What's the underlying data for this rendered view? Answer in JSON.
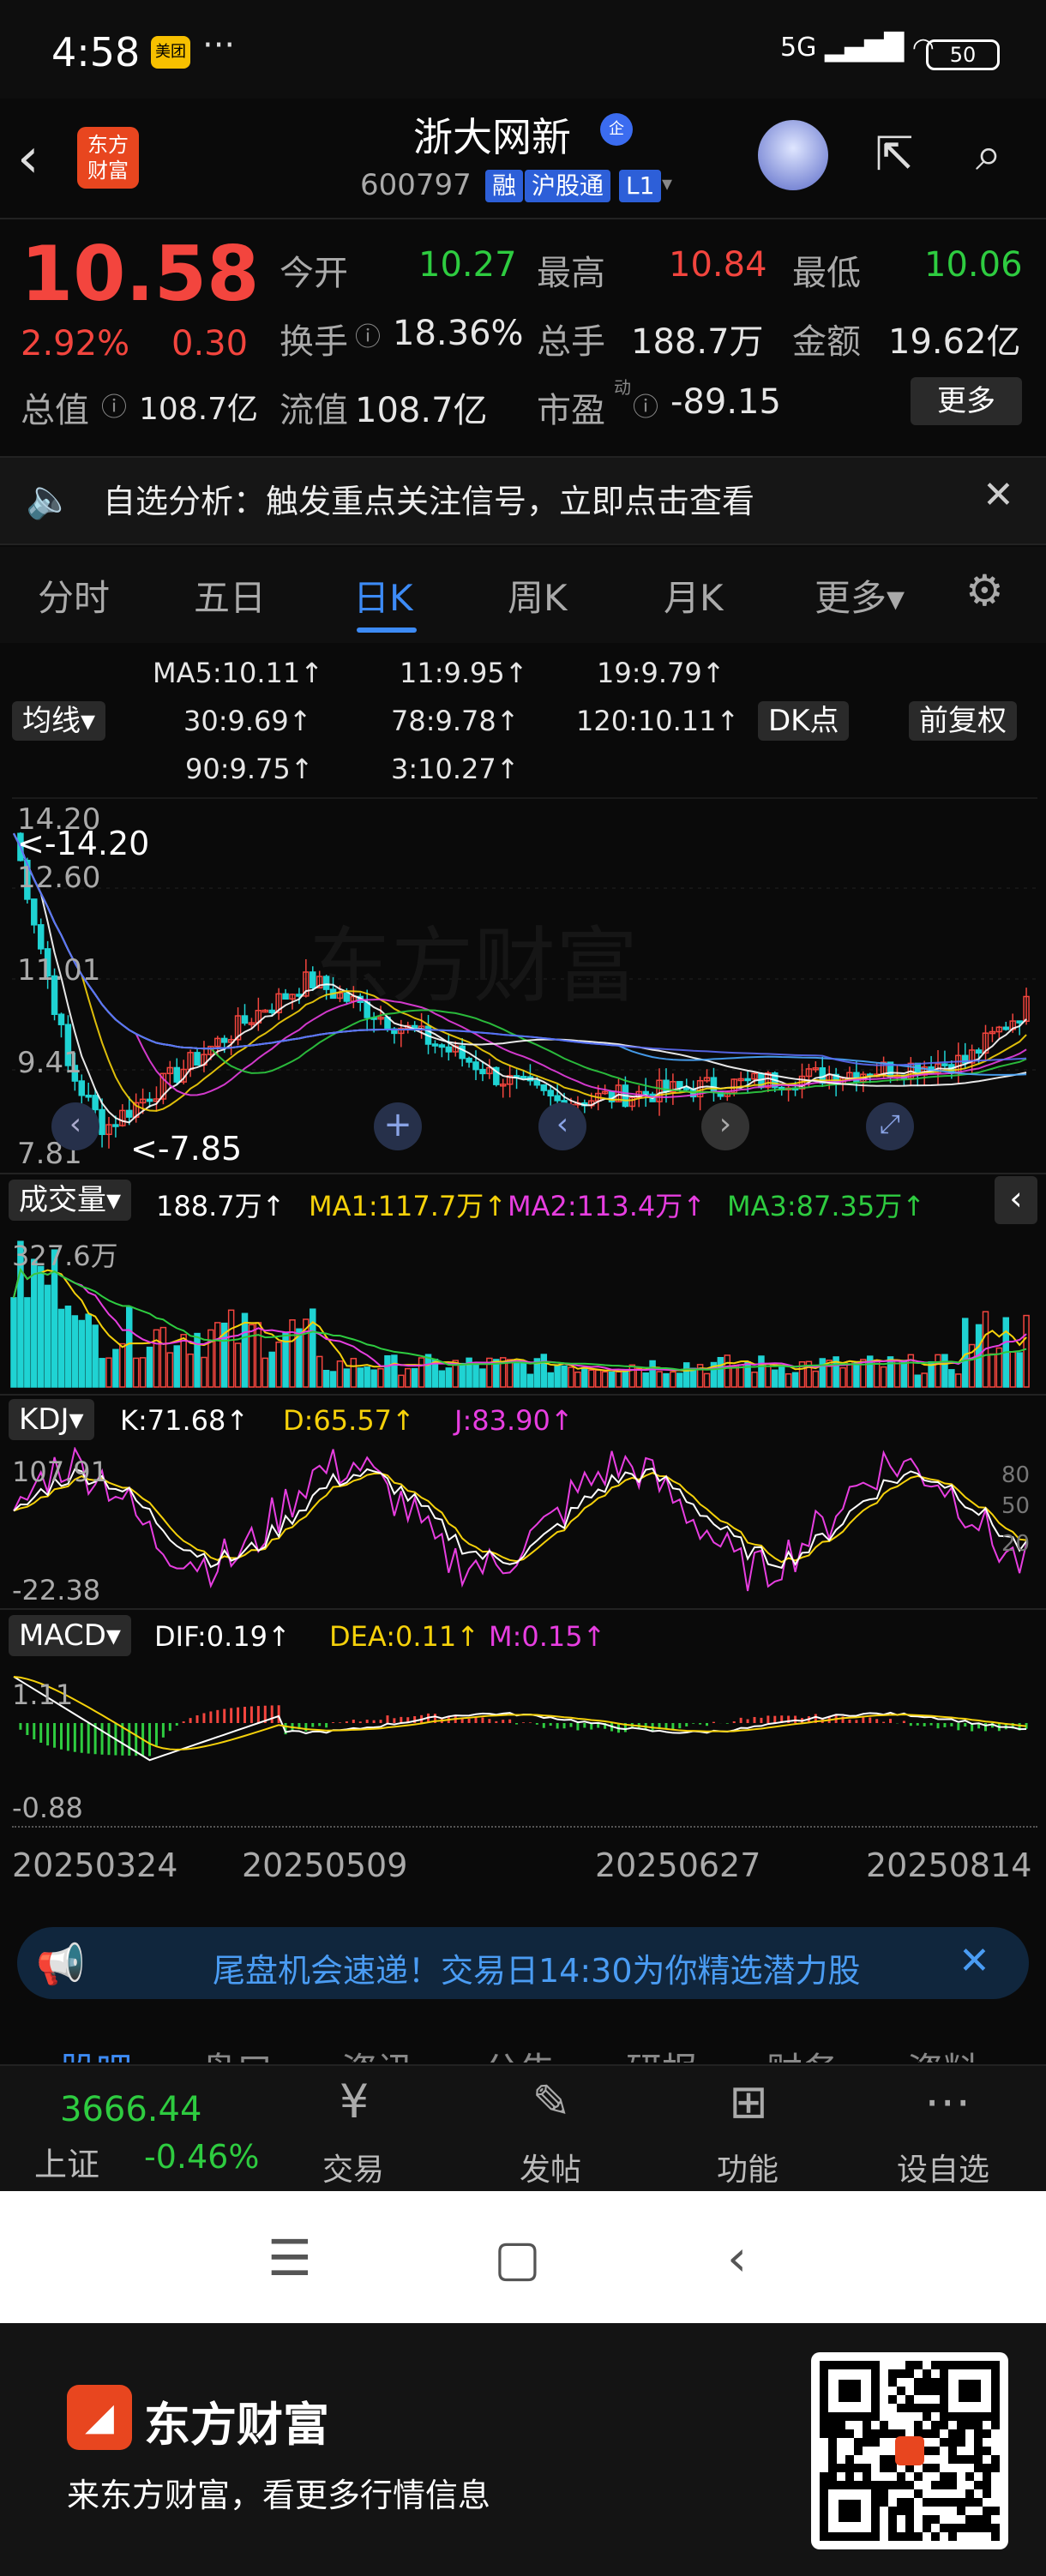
{
  "status_bar": {
    "time": "4:58",
    "app_badge": "美团",
    "dots": "···",
    "signal": "5G",
    "battery": "50"
  },
  "header": {
    "logo_text": "东方\n财富",
    "stock_name": "浙大网新",
    "name_badge": "企",
    "stock_code": "600797",
    "tags": [
      "融",
      "沪股通",
      "L1"
    ]
  },
  "quote": {
    "price": "10.58",
    "pct_change": "2.92%",
    "change": "0.30",
    "open_label": "今开",
    "open": "10.27",
    "high_label": "最高",
    "high": "10.84",
    "low_label": "最低",
    "low": "10.06",
    "turnover_label": "换手",
    "turnover": "18.36%",
    "volume_label": "总手",
    "volume": "188.7万",
    "amount_label": "金额",
    "amount": "19.62亿",
    "mktcap_label": "总值",
    "mktcap": "108.7亿",
    "float_label": "流值",
    "float_cap": "108.7亿",
    "pe_label": "市盈",
    "pe_sup": "动",
    "pe": "-89.15",
    "more_label": "更多",
    "colors": {
      "up": "#f3453e",
      "down": "#2ecc40"
    }
  },
  "notice": {
    "text": "自选分析：触发重点关注信号，立即点击查看"
  },
  "tabs": [
    "分时",
    "五日",
    "日K",
    "周K",
    "月K",
    "更多▾"
  ],
  "active_tab": "日K",
  "ma_legend": {
    "ma_selector": "均线▾",
    "dk_label": "DK点",
    "adjust_label": "前复权",
    "items": [
      {
        "label": "MA5:10.11↑",
        "color": "#ffffff"
      },
      {
        "label": "11:9.95↑",
        "color": "#f5d10a"
      },
      {
        "label": "19:9.79↑",
        "color": "#e73ee0"
      },
      {
        "label": "30:9.69↑",
        "color": "#2ecc40"
      },
      {
        "label": "78:9.78↑",
        "color": "#ffffff"
      },
      {
        "label": "120:10.11↑",
        "color": "#5b6cf5"
      },
      {
        "label": "90:9.75↑",
        "color": "#4aa8ff"
      },
      {
        "label": "3:10.27↑",
        "color": "#f3453e"
      }
    ]
  },
  "kline": {
    "max_label": "14.20",
    "max_marker": "<-14.20",
    "y_label_2": "12.60",
    "y_label_3": "11.01",
    "y_label_4": "9.41",
    "min_label": "7.81",
    "min_marker": "<-7.85",
    "watermark": "东方财富"
  },
  "volume_panel": {
    "selector": "成交量▾",
    "current": "188.7万↑",
    "ma1": "MA1:117.7万↑",
    "ma2": "MA2:113.4万↑",
    "ma3": "MA3:87.35万↑",
    "max_label": "327.6万"
  },
  "kdj_panel": {
    "selector": "KDJ▾",
    "k": "K:71.68↑",
    "d": "D:65.57↑",
    "j": "J:83.90↑",
    "top_label": "107.91",
    "bottom_label": "-22.38",
    "ref_80": "80",
    "ref_50": "50",
    "ref_20": "20"
  },
  "macd_panel": {
    "selector": "MACD▾",
    "dif": "DIF:0.19↑",
    "dea": "DEA:0.11↑",
    "m": "M:0.15↑",
    "top_label": "1.11",
    "bottom_label": "-0.88"
  },
  "dates": [
    "20250324",
    "20250509",
    "20250627",
    "20250814"
  ],
  "banner": {
    "text": "尾盘机会速递！交易日14:30为你精选潜力股"
  },
  "subtabs": [
    "股吧",
    "盘口",
    "资讯",
    "公告",
    "研报",
    "财务",
    "资料"
  ],
  "dock": {
    "index_value": "3666.44",
    "index_name": "上证",
    "index_change": "-0.46%",
    "items": [
      "交易",
      "发帖",
      "功能",
      "设自选"
    ]
  },
  "promo": {
    "brand": "东方财富",
    "tagline": "来东方财富，看更多行情信息"
  }
}
